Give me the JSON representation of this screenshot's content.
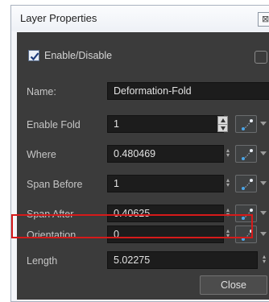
{
  "window": {
    "title": "Layer Properties",
    "close_glyph": "⊠"
  },
  "enable": {
    "label": "Enable/Disable",
    "checked": true
  },
  "fields": {
    "name": {
      "label": "Name:",
      "value": "Deformation-Fold"
    },
    "enable_fold": {
      "label": "Enable Fold",
      "value": "1"
    },
    "where": {
      "label": "Where",
      "value": "0.480469"
    },
    "span_before": {
      "label": "Span Before",
      "value": "1"
    },
    "span_after": {
      "label": "Span After",
      "value": "0.40625"
    },
    "orientation": {
      "label": "Orientation",
      "value": "0"
    },
    "length": {
      "label": "Length",
      "value": "5.02275"
    }
  },
  "buttons": {
    "close_label": "Close"
  },
  "icons": {
    "spinner": "spinner-icon",
    "function": "function-curve-icon",
    "dropdown": "chevron-down-icon"
  },
  "colors": {
    "panel": "#3b3b3b",
    "field": "#1c1c1c",
    "highlight": "#d61a1a",
    "function_dot": "#4aa6e8"
  }
}
